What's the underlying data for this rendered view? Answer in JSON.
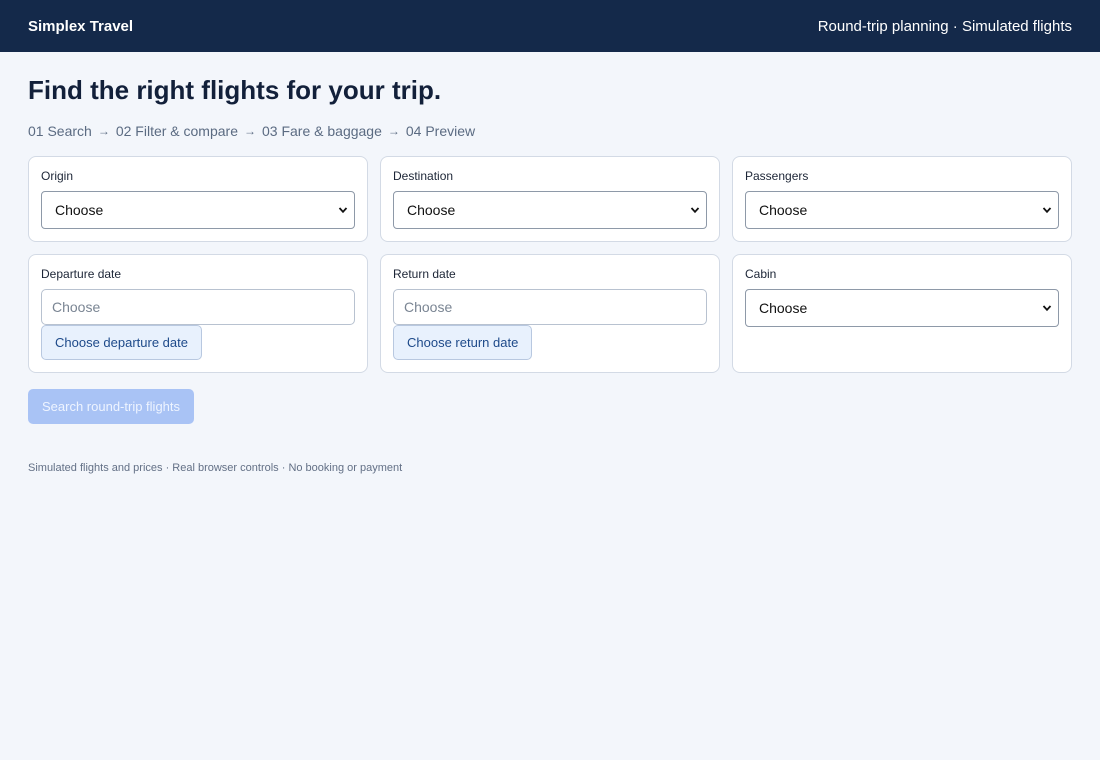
{
  "header": {
    "brand": "Simplex Travel",
    "tagline": "Round-trip planning · Simulated flights"
  },
  "page": {
    "title": "Find the right flights for your trip."
  },
  "steps": [
    "01 Search",
    "02 Filter & compare",
    "03 Fare & baggage",
    "04 Preview"
  ],
  "step_separator": "→",
  "form": {
    "origin": {
      "label": "Origin",
      "value": "Choose"
    },
    "destination": {
      "label": "Destination",
      "value": "Choose"
    },
    "passengers": {
      "label": "Passengers",
      "value": "Choose"
    },
    "departure_date": {
      "label": "Departure date",
      "placeholder": "Choose",
      "button": "Choose departure date"
    },
    "return_date": {
      "label": "Return date",
      "placeholder": "Choose",
      "button": "Choose return date"
    },
    "cabin": {
      "label": "Cabin",
      "value": "Choose"
    }
  },
  "search_button": "Search round-trip flights",
  "footer": "Simulated flights and prices · Real browser controls · No booking or payment",
  "colors": {
    "header_bg": "#14294a",
    "page_bg": "#f3f6fb",
    "search_button_disabled": "#a9c3f5",
    "date_button_bg": "#e8f1fd"
  },
  "icons": {
    "select_indicator": "chevron-down-icon"
  }
}
